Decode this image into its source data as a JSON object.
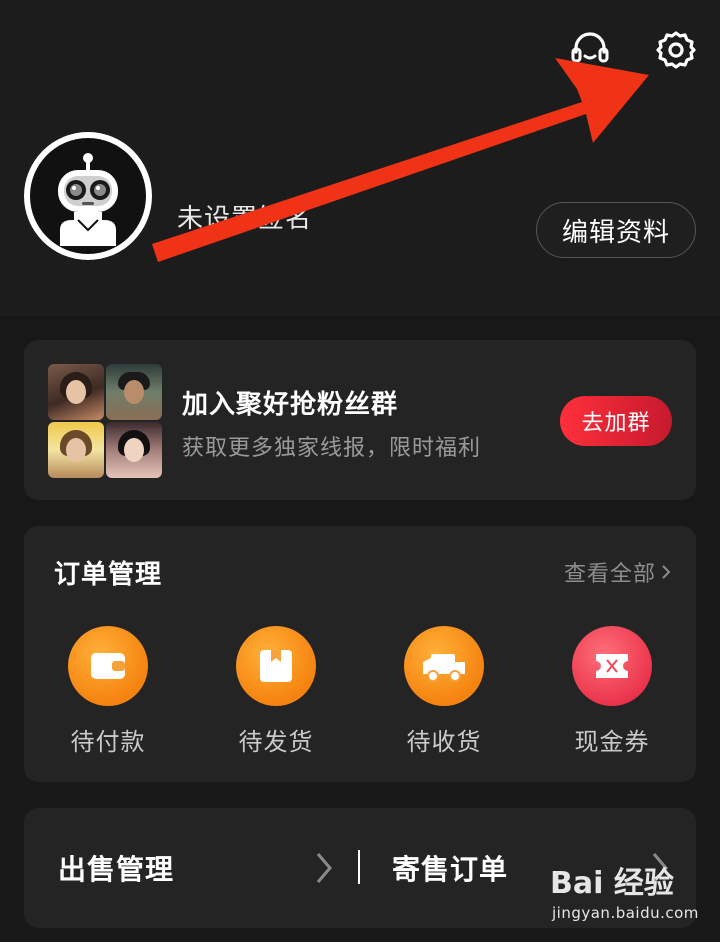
{
  "profile": {
    "signature": "未设置签名",
    "edit_button": "编辑资料"
  },
  "icons": {
    "support": "headset-icon",
    "settings": "gear-icon"
  },
  "fans_group": {
    "title": "加入聚好抢粉丝群",
    "subtitle": "获取更多独家线报，限时福利",
    "join_button": "去加群"
  },
  "orders": {
    "title": "订单管理",
    "view_all": "查看全部",
    "items": [
      {
        "label": "待付款",
        "icon": "wallet-icon"
      },
      {
        "label": "待发货",
        "icon": "package-icon"
      },
      {
        "label": "待收货",
        "icon": "truck-icon"
      },
      {
        "label": "现金券",
        "icon": "ticket-icon"
      }
    ]
  },
  "sales": {
    "left_label": "出售管理",
    "right_label": "寄售订单"
  },
  "watermark": {
    "brand": "Bai 经验",
    "url": "jingyan.baidu.com"
  },
  "colors": {
    "background": "#1b1b1b",
    "card": "#242424",
    "accent_red": "#ff2f3c",
    "orange": "#f5830f",
    "annotation_arrow": "#f03316"
  }
}
